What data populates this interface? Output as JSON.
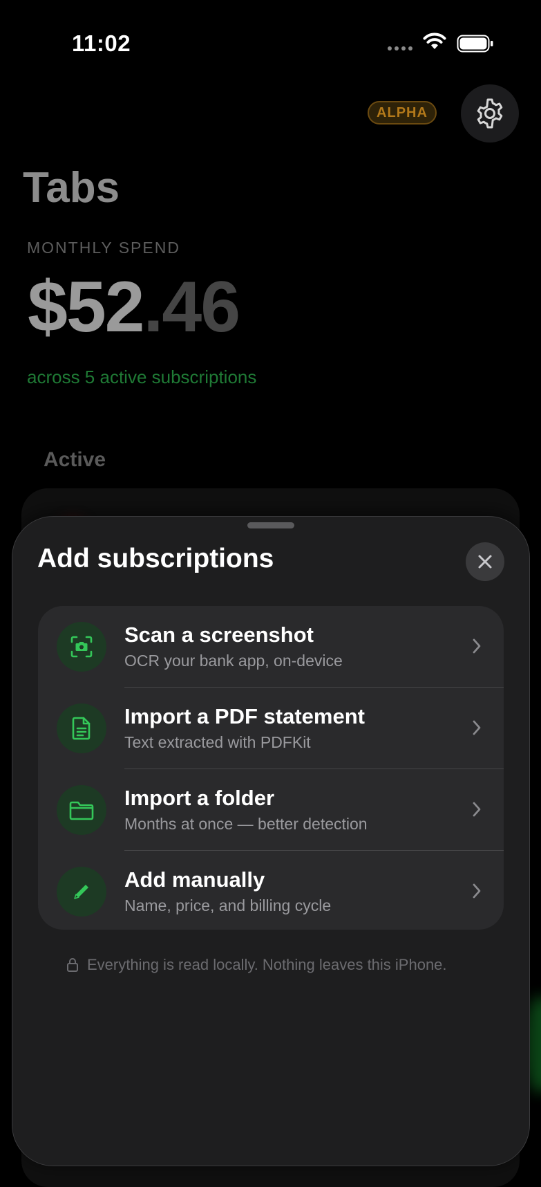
{
  "status_bar": {
    "time": "11:02",
    "wifi_icon": "wifi-icon",
    "battery_icon": "battery-icon"
  },
  "header": {
    "badge": "ALPHA",
    "settings_icon": "gear-icon"
  },
  "app": {
    "title": "Tabs",
    "spend_label": "MONTHLY SPEND",
    "spend_whole": "$52",
    "spend_fraction": ".46",
    "caption": "across 5 active subscriptions",
    "section_title": "Active"
  },
  "sheet": {
    "title": "Add subscriptions",
    "close_icon": "close-icon",
    "options": [
      {
        "icon": "camera-scan-icon",
        "title": "Scan a screenshot",
        "subtitle": "OCR your bank app, on-device"
      },
      {
        "icon": "document-icon",
        "title": "Import a PDF statement",
        "subtitle": "Text extracted with PDFKit"
      },
      {
        "icon": "folder-icon",
        "title": "Import a folder",
        "subtitle": "Months at once — better detection"
      },
      {
        "icon": "pencil-icon",
        "title": "Add manually",
        "subtitle": "Name, price, and billing cycle"
      }
    ],
    "privacy_note": "Everything is read locally. Nothing leaves this iPhone.",
    "privacy_icon": "lock-icon"
  },
  "colors": {
    "accent": "#34c759",
    "badge": "#b3791a",
    "sheet_bg": "#1e1e1f",
    "card_bg": "#2a2a2c"
  }
}
